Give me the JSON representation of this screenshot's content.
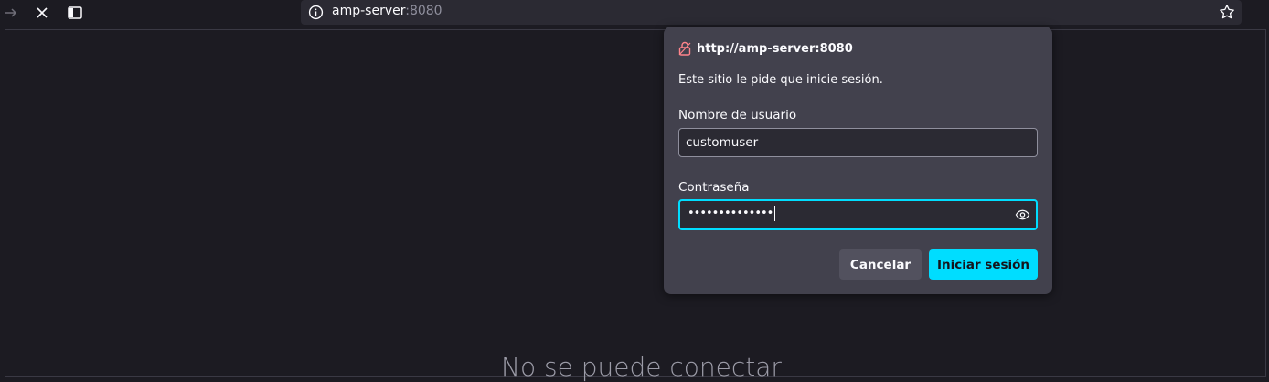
{
  "browser": {
    "url_host": "amp-server",
    "url_port": ":8080"
  },
  "page": {
    "error_title": "No se puede conectar"
  },
  "dialog": {
    "origin": "http://amp-server:8080",
    "message": "Este sitio le pide que inicie sesión.",
    "username_label": "Nombre de usuario",
    "username_value": "customuser",
    "password_label": "Contraseña",
    "password_mask": "••••••••••••••",
    "cancel_label": "Cancelar",
    "login_label": "Iniciar sesión"
  },
  "colors": {
    "accent": "#00ddff",
    "dialog_bg": "#42414d",
    "page_bg": "#1c1b22"
  }
}
